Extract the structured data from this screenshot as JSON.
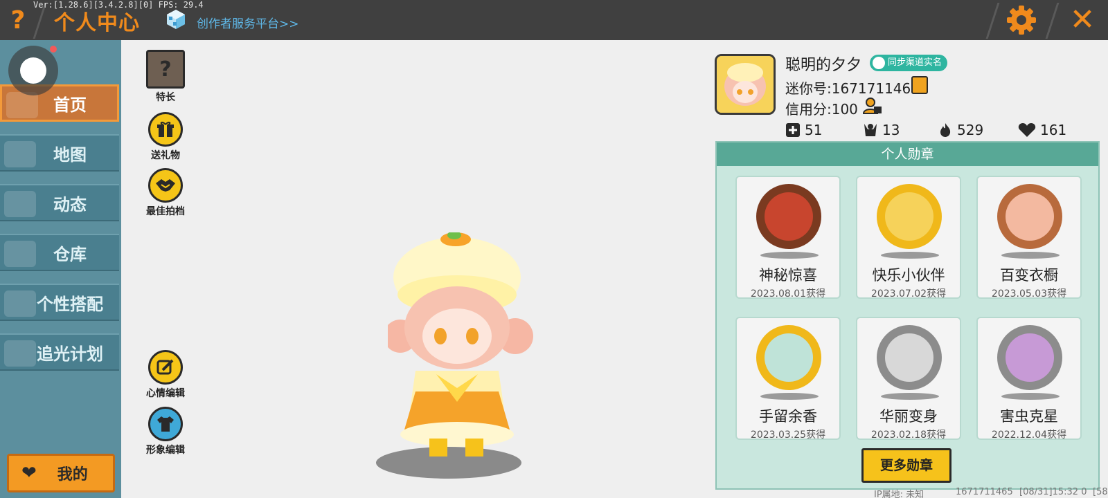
{
  "topbar": {
    "help_icon": "?",
    "version": "Ver:[1.28.6][3.4.2.8][0] FPS: 29.4",
    "title": "个人中心",
    "creator_link": "创作者服务平台>>",
    "close_icon": "✕",
    "accent": "#f08a1c"
  },
  "sidebar": {
    "items": [
      {
        "label": "首页",
        "active": true
      },
      {
        "label": "地图",
        "active": false
      },
      {
        "label": "动态",
        "active": false
      },
      {
        "label": "仓库",
        "active": false
      },
      {
        "label": "个性搭配",
        "active": false
      },
      {
        "label": "追光计划",
        "active": false
      }
    ],
    "mine_label": "我的",
    "mine_icon": "❤"
  },
  "actions": {
    "specialty": {
      "label": "特长",
      "icon": "?"
    },
    "send_gift": {
      "label": "送礼物"
    },
    "best_partner": {
      "label": "最佳拍档"
    },
    "mood_edit": {
      "label": "心情编辑"
    },
    "avatar_edit": {
      "label": "形象编辑"
    }
  },
  "profile": {
    "name": "聪明的夕夕",
    "sync_badge": "同步渠道实名",
    "mini_id": "迷你号:1671711465",
    "credit": "信用分:100",
    "stats": {
      "posts": "51",
      "followers": "13",
      "heat": "529",
      "likes": "161"
    }
  },
  "medals": {
    "header": "个人勋章",
    "items": [
      {
        "name": "神秘惊喜",
        "date": "2023.08.01获得",
        "ring": "#7a3a20",
        "inner": "#c8452e"
      },
      {
        "name": "快乐小伙伴",
        "date": "2023.07.02获得",
        "ring": "#f0b81a",
        "inner": "#f6d25a"
      },
      {
        "name": "百变衣橱",
        "date": "2023.05.03获得",
        "ring": "#b86a3c",
        "inner": "#f3b9a0"
      },
      {
        "name": "手留余香",
        "date": "2023.03.25获得",
        "ring": "#f0b81a",
        "inner": "#bfe3d8"
      },
      {
        "name": "华丽变身",
        "date": "2023.02.18获得",
        "ring": "#8c8c8c",
        "inner": "#d8d8d8"
      },
      {
        "name": "害虫克星",
        "date": "2022.12.04获得",
        "ring": "#8c8c8c",
        "inner": "#c79ad6"
      }
    ],
    "more_label": "更多勋章"
  },
  "status": {
    "ip": "IP属地: 未知",
    "uid": "1671711465",
    "time": "[08/31]15:32 0",
    "tail": "[58"
  }
}
